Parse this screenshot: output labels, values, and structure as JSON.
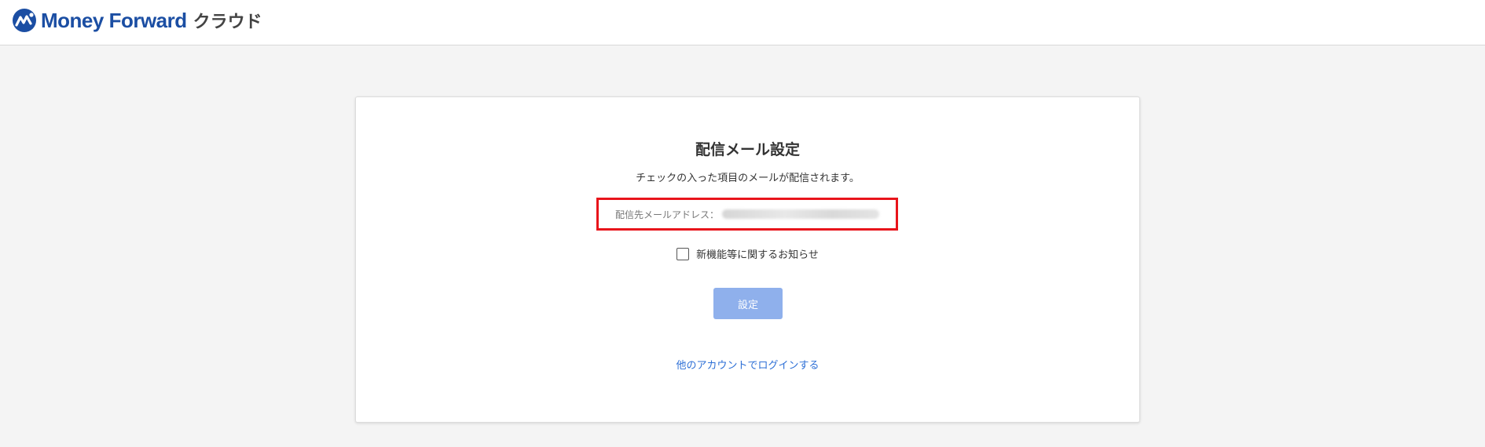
{
  "header": {
    "brand": "Money Forward",
    "suffix": "クラウド",
    "brand_color": "#1b4ea3"
  },
  "card": {
    "title": "配信メール設定",
    "subtitle": "チェックの入った項目のメールが配信されます。",
    "email_label": "配信先メールアドレス：",
    "highlight_color": "#e8141b",
    "checkbox_label": "新機能等に関するお知らせ",
    "checkbox_checked": false,
    "submit_label": "設定",
    "submit_color": "#8fb0ec",
    "alt_login_label": "他のアカウントでログインする",
    "link_color": "#2d6fd6"
  }
}
